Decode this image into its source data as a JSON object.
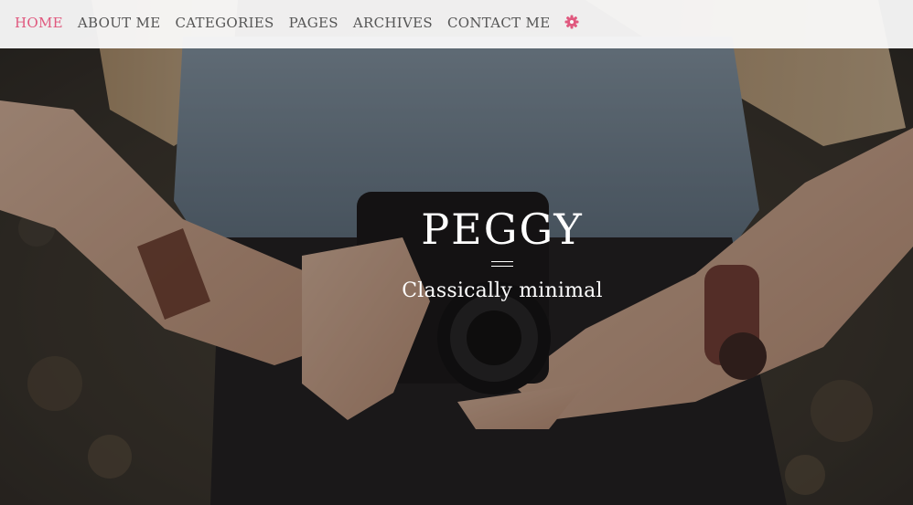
{
  "nav": {
    "items": [
      {
        "label": "HOME",
        "active": true
      },
      {
        "label": "ABOUT ME",
        "active": false
      },
      {
        "label": "CATEGORIES",
        "active": false
      },
      {
        "label": "PAGES",
        "active": false
      },
      {
        "label": "ARCHIVES",
        "active": false
      },
      {
        "label": "CONTACT ME",
        "active": false
      }
    ],
    "settings_icon": "gear-icon"
  },
  "hero": {
    "title": "PEGGY",
    "tagline": "Classically minimal",
    "background": "woman-holding-camera-photo"
  },
  "colors": {
    "accent": "#e0587e",
    "nav_text": "#555555",
    "nav_bg": "#fafafa",
    "hero_text": "#ffffff"
  }
}
